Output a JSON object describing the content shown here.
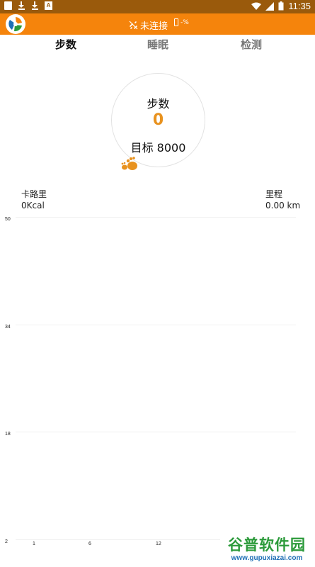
{
  "status_bar": {
    "time": "11:35"
  },
  "app_bar": {
    "connection_status": "未连接",
    "battery_text": "-%"
  },
  "tabs": [
    {
      "label": "步数",
      "active": true
    },
    {
      "label": "睡眠",
      "active": false
    },
    {
      "label": "检测",
      "active": false
    }
  ],
  "steps": {
    "title": "步数",
    "value": "0",
    "goal": "目标 8000"
  },
  "stats": {
    "calories_label": "卡路里",
    "calories_value": "0Kcal",
    "distance_label": "里程",
    "distance_value": "0.00 km"
  },
  "chart_data": {
    "type": "bar",
    "y_ticks": [
      "50",
      "34",
      "18",
      "2"
    ],
    "x_ticks": [
      "1",
      "6",
      "12"
    ],
    "ylim": [
      2,
      50
    ],
    "values": []
  },
  "watermark": {
    "name": "谷普软件园",
    "url": "www.gupuxiazai.com"
  },
  "colors": {
    "accent": "#f5840c",
    "status_bar": "#9a5a0c",
    "step_value": "#e8921f"
  }
}
